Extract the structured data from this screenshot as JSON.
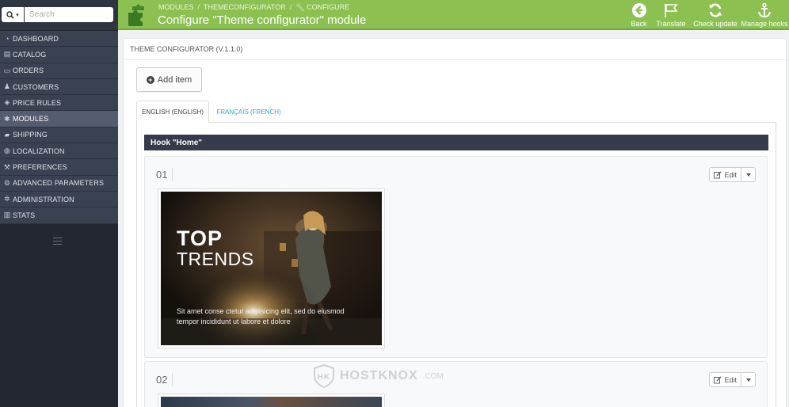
{
  "search": {
    "placeholder": "Search"
  },
  "sidebar": {
    "items": [
      {
        "label": "DASHBOARD",
        "icon": "dashboard-icon",
        "active": false
      },
      {
        "label": "CATALOG",
        "icon": "catalog-icon",
        "active": false
      },
      {
        "label": "ORDERS",
        "icon": "orders-icon",
        "active": false
      },
      {
        "label": "CUSTOMERS",
        "icon": "customers-icon",
        "active": false
      },
      {
        "label": "PRICE RULES",
        "icon": "tag-icon",
        "active": false
      },
      {
        "label": "MODULES",
        "icon": "puzzle-icon",
        "active": true
      },
      {
        "label": "SHIPPING",
        "icon": "truck-icon",
        "active": false
      },
      {
        "label": "LOCALIZATION",
        "icon": "globe-icon",
        "active": false
      },
      {
        "label": "PREFERENCES",
        "icon": "wrench-icon",
        "active": false
      },
      {
        "label": "ADVANCED PARAMETERS",
        "icon": "cogs-icon",
        "active": false
      },
      {
        "label": "ADMINISTRATION",
        "icon": "cog-icon",
        "active": false
      },
      {
        "label": "STATS",
        "icon": "stats-icon",
        "active": false
      }
    ]
  },
  "header": {
    "breadcrumb": [
      "MODULES",
      "THEMECONFIGURATOR",
      "CONFIGURE"
    ],
    "title": "Configure \"Theme configurator\" module",
    "toolbar": {
      "back": "Back",
      "translate": "Translate",
      "check_update": "Check update",
      "manage_hooks": "Manage hooks"
    }
  },
  "panel": {
    "heading": "THEME CONFIGURATOR (V.1.1.0)",
    "add_item": "Add item",
    "tabs": [
      "ENGLISH (ENGLISH)",
      "FRANÇAIS (FRENCH)"
    ],
    "hook_title": "Hook \"Home\"",
    "items": [
      {
        "number": "01",
        "edit": "Edit",
        "title1": "TOP",
        "title2": "TRENDS",
        "caption": "Sit amet conse ctetur adipisicing elit, sed do eiusmod tempor incididunt ut labore et dolore"
      },
      {
        "number": "02",
        "edit": "Edit"
      }
    ]
  },
  "watermark": {
    "text": "HOSTKNOX",
    "suffix": ".COM"
  },
  "colors": {
    "header": "#8cc152",
    "sidebar": "#23272f",
    "hook_bar": "#363a4a",
    "link": "#26a9d6"
  }
}
